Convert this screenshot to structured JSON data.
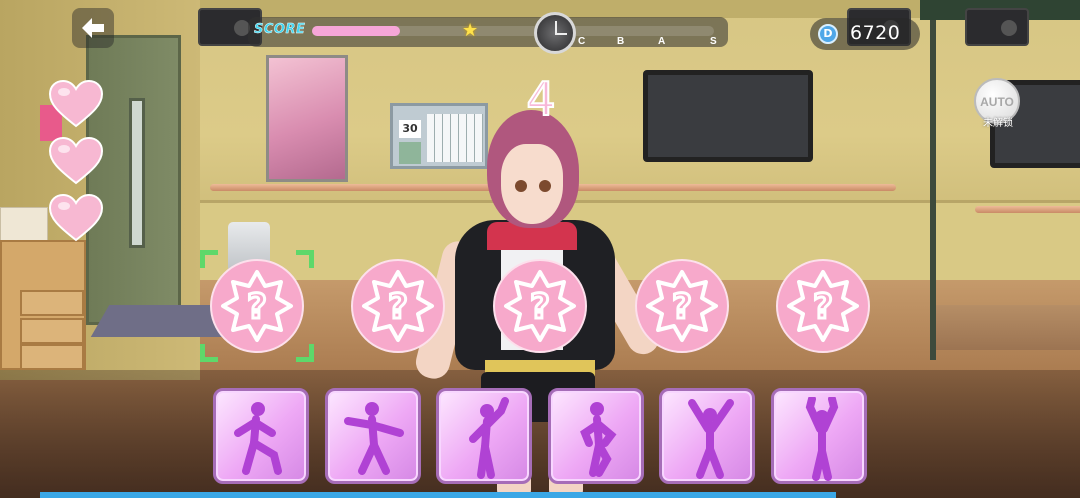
{
  "hud": {
    "score_label": "SCORE",
    "score_progress": 0.22,
    "ranks": [
      "C",
      "B",
      "A",
      "S"
    ],
    "coins": "6720",
    "coin_icon_letter": "D",
    "auto_label": "AUTO",
    "auto_sub_label": "未解锁",
    "countdown": "4"
  },
  "lives": {
    "count": 3,
    "icon": "heart-icon",
    "color": "#f7b8d2"
  },
  "slots": [
    {
      "icon": "question-badge-icon",
      "selected": true
    },
    {
      "icon": "question-badge-icon",
      "selected": false
    },
    {
      "icon": "question-badge-icon",
      "selected": false
    },
    {
      "icon": "question-badge-icon",
      "selected": false
    },
    {
      "icon": "question-badge-icon",
      "selected": false
    }
  ],
  "moves": [
    {
      "icon": "dance-pose-kick-icon"
    },
    {
      "icon": "dance-pose-arms-out-icon"
    },
    {
      "icon": "dance-pose-point-up-icon"
    },
    {
      "icon": "dance-pose-hand-hip-icon"
    },
    {
      "icon": "dance-pose-arms-v-icon"
    },
    {
      "icon": "dance-pose-arms-up-icon"
    }
  ],
  "colors": {
    "accent_pink": "#f6a6d8",
    "score_text": "#3fd6f0",
    "selector_green": "#5ed86a",
    "progress_blue": "#3aa7e6"
  }
}
